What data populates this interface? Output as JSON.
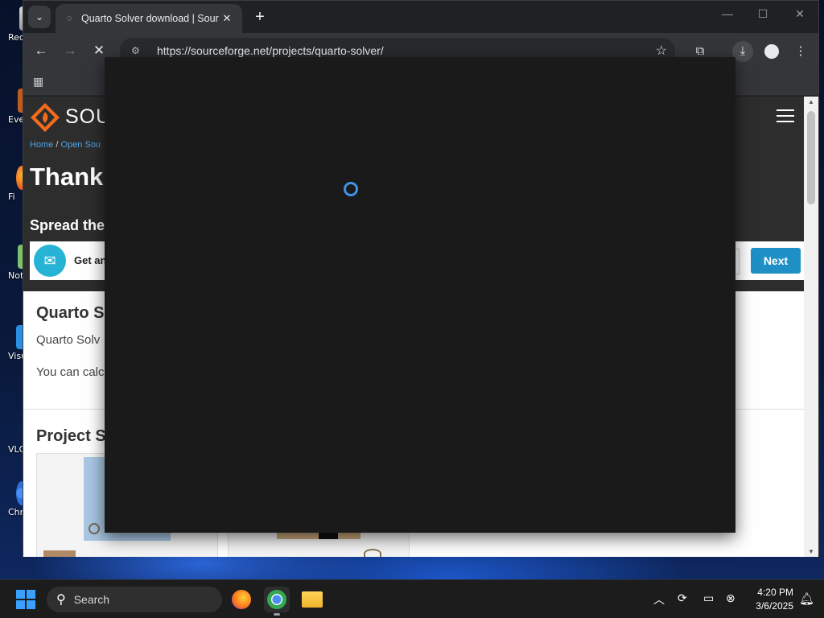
{
  "desktop": {
    "icons": [
      {
        "label": "Rec",
        "icon": "recycle-bin-icon"
      },
      {
        "label": "Eve",
        "icon": "app-shortcut-icon"
      },
      {
        "label": "Fi",
        "icon": "firefox-shortcut-icon"
      },
      {
        "label": "Not",
        "icon": "notepad-shortcut-icon"
      },
      {
        "label": "Visu",
        "icon": "vscode-shortcut-icon"
      },
      {
        "label": "VLC",
        "icon": "vlc-shortcut-icon"
      },
      {
        "label": "Chr",
        "icon": "chrome-shortcut-icon"
      }
    ]
  },
  "browser": {
    "tab": {
      "title": "Quarto Solver download | Sour",
      "favicon": "loading-favicon-icon"
    },
    "new_tab_label": "+",
    "url": "https://sourceforge.net/projects/quarto-solver/",
    "controls": {
      "minimize": "—",
      "maximize": "☐",
      "close": "✕"
    }
  },
  "page": {
    "wordmark": "SOU",
    "breadcrumb": {
      "home": "Home",
      "sep": " / ",
      "open_source": "Open Sou"
    },
    "thank_heading": "Thank y",
    "spread_heading": "Spread the V",
    "newsletter": {
      "text": "Get an",
      "next_label": "Next"
    },
    "project": {
      "title": "Quarto So",
      "desc": "Quarto Solv",
      "calc": "You can calc"
    },
    "screenshots_title": "Project Sa"
  },
  "taskbar": {
    "search_label": "Search",
    "time": "4:20 PM",
    "date": "3/6/2025"
  },
  "colors": {
    "accent": "#1e90c6",
    "spinner": "#3f92e8",
    "sf_orange": "#f26b1d"
  }
}
